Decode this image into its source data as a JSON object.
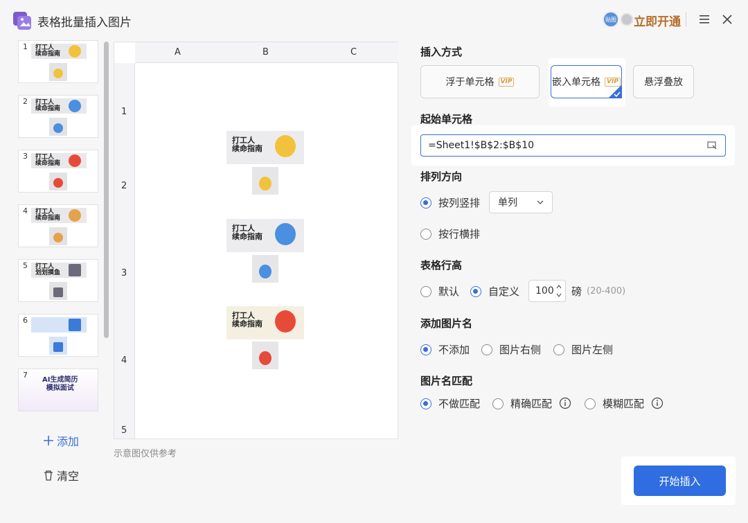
{
  "window": {
    "title": "表格批量插入图片"
  },
  "header": {
    "avatar_text": "贴图",
    "open_vip": "立即开通"
  },
  "sidebar": {
    "items": [
      {
        "num": "1",
        "text": "打工人\n续命指南",
        "face_color": "#f2c23c"
      },
      {
        "num": "2",
        "text": "打工人\n续命指南",
        "face_color": "#4a8fe0"
      },
      {
        "num": "3",
        "text": "打工人\n续命指南",
        "face_color": "#e84a3a"
      },
      {
        "num": "4",
        "text": "打工人\n续命指南",
        "face_color": "#e6a24a"
      },
      {
        "num": "5",
        "text": "打工人\n划划摸鱼",
        "face_color": "#6a6a7a"
      },
      {
        "num": "6",
        "text": "",
        "face_color": "#3a7ad8"
      },
      {
        "num": "7",
        "text": "AI生成简历\n模拟面试",
        "face_color": "#b9a8e6"
      }
    ],
    "add_label": "添加",
    "clear_label": "清空"
  },
  "preview": {
    "columns": [
      "A",
      "B",
      "C"
    ],
    "rows": [
      "1",
      "2",
      "3",
      "4",
      "5"
    ],
    "poster_text": "打工人\n续命指南",
    "caption": "示意图仅供参考"
  },
  "settings": {
    "insert_mode": {
      "title": "插入方式",
      "options": [
        {
          "label": "浮于单元格",
          "vip": "VIP",
          "selected": false
        },
        {
          "label": "嵌入单元格",
          "vip": "VIP",
          "selected": true
        },
        {
          "label": "悬浮叠放",
          "vip": "",
          "selected": false
        }
      ]
    },
    "start_cell": {
      "title": "起始单元格",
      "value": "=Sheet1!$B$2:$B$10"
    },
    "direction": {
      "title": "排列方向",
      "by_column": "按列竖排",
      "by_row": "按行横排",
      "column_option": "单列",
      "selected": "by_column"
    },
    "row_height": {
      "title": "表格行高",
      "default_label": "默认",
      "custom_label": "自定义",
      "value": "100",
      "unit": "磅",
      "range_hint": "(20-400)",
      "selected": "custom"
    },
    "image_name": {
      "title": "添加图片名",
      "options": [
        "不添加",
        "图片右侧",
        "图片左侧"
      ],
      "selected": 0
    },
    "name_match": {
      "title": "图片名匹配",
      "options": [
        "不做匹配",
        "精确匹配",
        "模糊匹配"
      ],
      "selected": 0
    }
  },
  "actions": {
    "start": "开始插入"
  },
  "colors": {
    "accent": "#2f6de0",
    "vip": "#b96d27"
  }
}
